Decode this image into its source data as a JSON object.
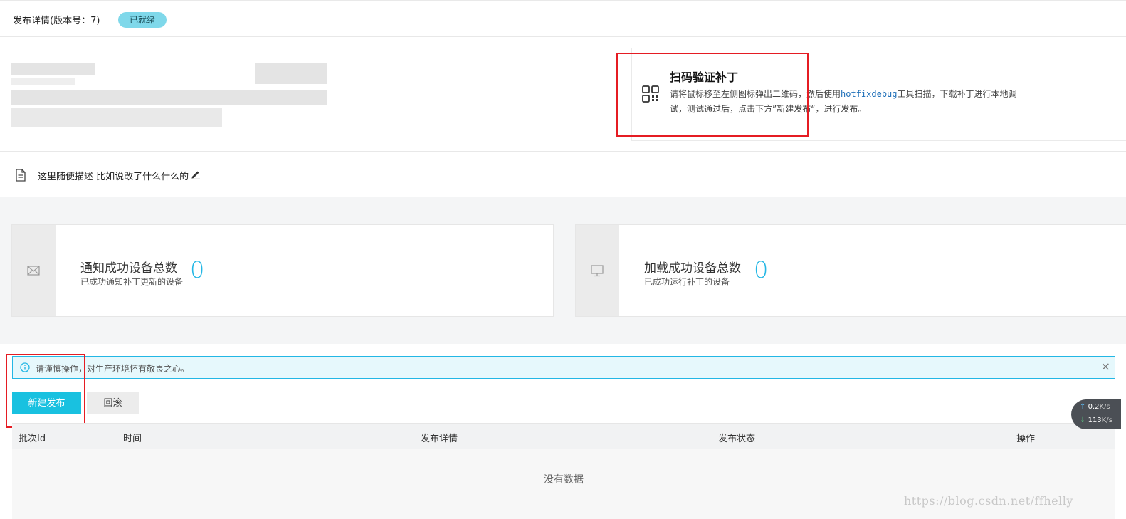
{
  "header": {
    "title": "发布详情(版本号：7)",
    "status_badge": "已就绪"
  },
  "scan": {
    "title": "扫码验证补丁",
    "desc_before": "请将鼠标移至左侧图标弹出二维码，然后使用",
    "desc_code": "hotfixdebug",
    "desc_after": "工具扫描，下载补丁进行本地调试，测试通过后，点击下方”新建发布“，进行发布。",
    "icon": "qrcode-icon"
  },
  "description": {
    "text": "这里随便描述  比如说改了什么什么的",
    "doc_icon": "document-icon",
    "edit_icon": "edit-pen-icon"
  },
  "stats": [
    {
      "title": "通知成功设备总数",
      "subtitle": "已成功通知补丁更新的设备",
      "value": "0",
      "icon": "envelope-icon"
    },
    {
      "title": "加载成功设备总数",
      "subtitle": "已成功运行补丁的设备",
      "value": "0",
      "icon": "monitor-icon"
    }
  ],
  "alert": {
    "text": "请谨慎操作，对生产环境怀有敬畏之心。",
    "close": "×",
    "icon": "info-icon"
  },
  "buttons": {
    "new_release": "新建发布",
    "rollback": "回滚"
  },
  "table": {
    "columns": [
      "批次Id",
      "时间",
      "发布详情",
      "发布状态",
      "操作"
    ],
    "empty_text": "没有数据"
  },
  "speed_widget": {
    "upload": "0.2",
    "upload_unit": "K/s",
    "download": "113",
    "download_unit": "K/s"
  },
  "watermark": "https://blog.csdn.net/ffhelly",
  "colors": {
    "accent": "#19c1e0",
    "badge": "#7fd8ea",
    "highlight_box": "#e51c23",
    "stat_number": "#23b7e5"
  }
}
